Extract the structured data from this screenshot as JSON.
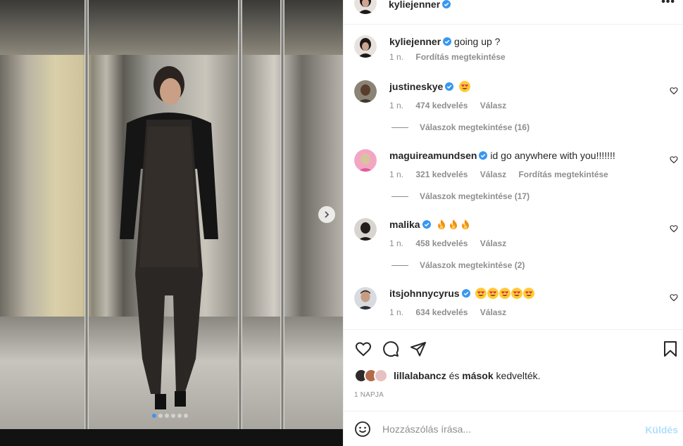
{
  "post": {
    "author": "kyliejenner",
    "more_label": "•••",
    "caption": {
      "username": "kyliejenner",
      "text": "going up ?",
      "time": "1 n.",
      "translate": "Fordítás megtekintése"
    }
  },
  "comments": [
    {
      "username": "justineskye",
      "verified": true,
      "emojis": [
        "heart-eyes"
      ],
      "text": "",
      "time": "1 n.",
      "likes": "474 kedvelés",
      "reply": "Válasz",
      "translate": "",
      "replies": "Válaszok megtekintése (16)"
    },
    {
      "username": "maguireamundsen",
      "verified": true,
      "emojis": [],
      "text": "id go anywhere with you!!!!!!!",
      "time": "1 n.",
      "likes": "321 kedvelés",
      "reply": "Válasz",
      "translate": "Fordítás megtekintése",
      "replies": "Válaszok megtekintése (17)"
    },
    {
      "username": "malika",
      "verified": true,
      "emojis": [
        "fire",
        "fire",
        "fire"
      ],
      "text": "",
      "time": "1 n.",
      "likes": "458 kedvelés",
      "reply": "Válasz",
      "translate": "",
      "replies": "Válaszok megtekintése (2)"
    },
    {
      "username": "itsjohnnycyrus",
      "verified": true,
      "emojis": [
        "heart-eyes",
        "heart-eyes",
        "heart-eyes",
        "heart-eyes",
        "heart-eyes"
      ],
      "text": "",
      "time": "1 n.",
      "likes": "634 kedvelés",
      "reply": "Válasz",
      "translate": "",
      "replies": ""
    }
  ],
  "likes_summary": {
    "user": "lillalabancz",
    "connector": "és",
    "others": "mások",
    "suffix": "kedvelték."
  },
  "date_label": "1 NAPJA",
  "comment_input": {
    "placeholder": "Hozzászólás írása...",
    "value": "",
    "send_label": "Küldés"
  },
  "carousel": {
    "slides": 6,
    "active": 1
  },
  "colors": {
    "verified": "#3897f0",
    "muted": "#8e8e8e",
    "text": "#262626",
    "send_disabled": "#b2dffc"
  },
  "icons": [
    "more-icon",
    "heart-icon",
    "comment-icon",
    "share-icon",
    "bookmark-icon",
    "emoji-icon",
    "chevron-right-icon",
    "verified-icon"
  ]
}
